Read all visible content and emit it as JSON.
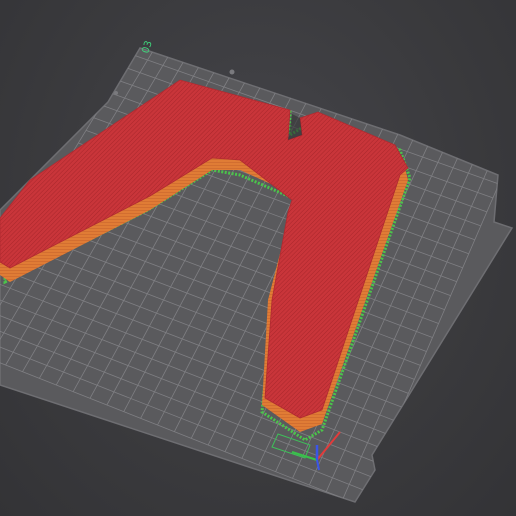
{
  "viewport": {
    "bed_label": "03"
  },
  "colors": {
    "background": "#3b3b3e",
    "bed": "#5a5a5d",
    "grid": "#86868a",
    "part_top": "#c9353a",
    "part_wall": "#e07c35",
    "support": "#4bc44b",
    "axis_x": "#e23b3b",
    "axis_y": "#39c24a",
    "axis_z": "#3a55e8"
  },
  "icons": {
    "axes": "xyz-axes-gizmo"
  }
}
